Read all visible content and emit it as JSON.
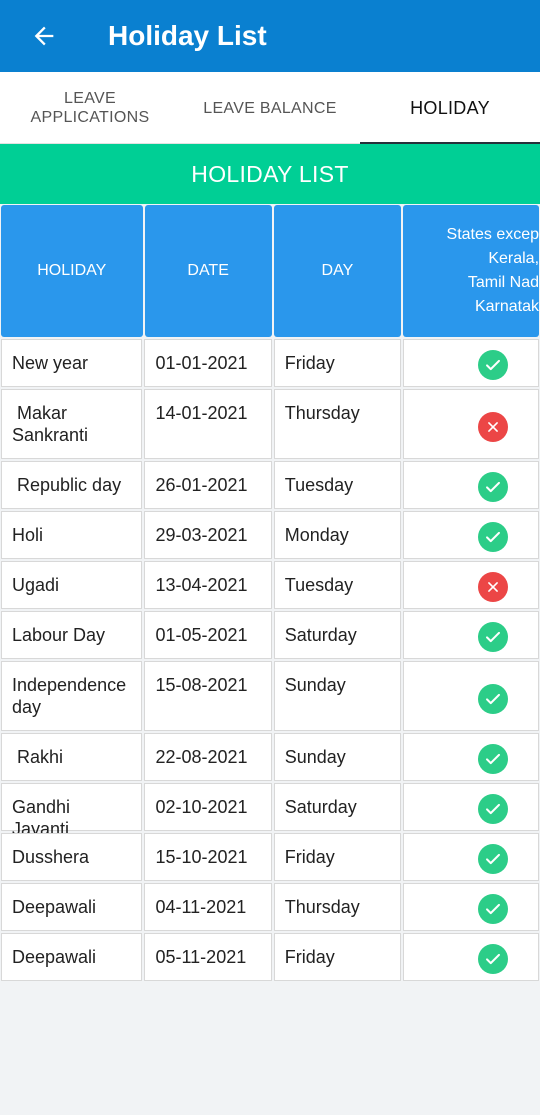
{
  "appbar": {
    "title": "Holiday List",
    "back_icon": "arrow-left-icon"
  },
  "tabs": [
    {
      "label": "LEAVE\nAPPLICATIONS",
      "active": false
    },
    {
      "label": "LEAVE BALANCE",
      "active": false
    },
    {
      "label": "HOLIDAY",
      "active": true
    }
  ],
  "banner": {
    "title": "HOLIDAY LIST"
  },
  "table": {
    "headers": [
      "HOLIDAY",
      "DATE",
      "DAY",
      "States excep\nKerala,\nTamil Nad\nKarnatak"
    ],
    "rows": [
      {
        "holiday": "New year",
        "date": "01-01-2021",
        "day": "Friday",
        "status": "yes"
      },
      {
        "holiday": " Makar Sankranti",
        "date": "14-01-2021",
        "day": "Thursday",
        "status": "no"
      },
      {
        "holiday": " Republic day",
        "date": "26-01-2021",
        "day": "Tuesday",
        "status": "yes"
      },
      {
        "holiday": "Holi",
        "date": "29-03-2021",
        "day": "Monday",
        "status": "yes"
      },
      {
        "holiday": "Ugadi",
        "date": "13-04-2021",
        "day": "Tuesday",
        "status": "no"
      },
      {
        "holiday": "Labour Day",
        "date": "01-05-2021",
        "day": "Saturday",
        "status": "yes"
      },
      {
        "holiday": "Independence day",
        "date": "15-08-2021",
        "day": "Sunday",
        "status": "yes"
      },
      {
        "holiday": " Rakhi",
        "date": "22-08-2021",
        "day": "Sunday",
        "status": "yes"
      },
      {
        "holiday": "Gandhi Jayanti",
        "date": "02-10-2021",
        "day": "Saturday",
        "status": "yes"
      },
      {
        "holiday": "Dusshera",
        "date": "15-10-2021",
        "day": "Friday",
        "status": "yes"
      },
      {
        "holiday": "Deepawali",
        "date": "04-11-2021",
        "day": "Thursday",
        "status": "yes"
      },
      {
        "holiday": "Deepawali",
        "date": "05-11-2021",
        "day": "Friday",
        "status": "yes"
      }
    ]
  },
  "colors": {
    "appbar": "#0a80d0",
    "banner": "#00cf95",
    "header_cell": "#2a97ec",
    "check": "#2ccd88",
    "cross": "#ec4646"
  }
}
